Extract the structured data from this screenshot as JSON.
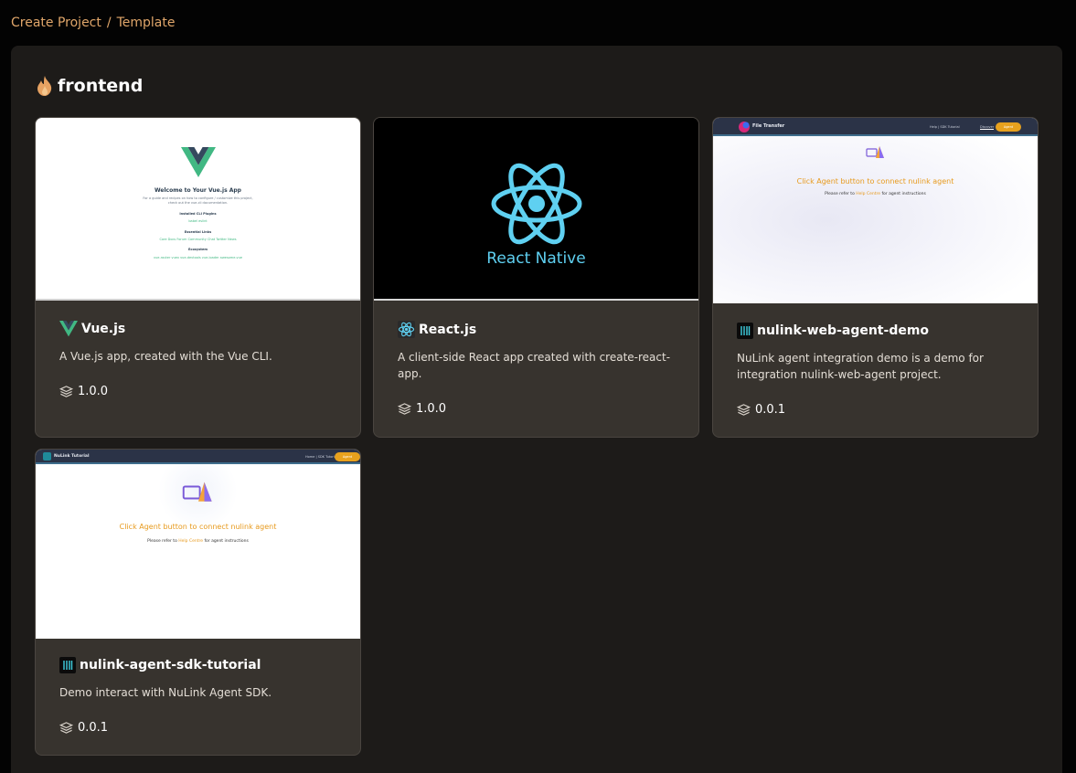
{
  "breadcrumb": {
    "root": "Create Project",
    "separator": "/",
    "current": "Template"
  },
  "section": {
    "title": "frontend",
    "icon": "flame-icon"
  },
  "colors": {
    "accent": "#e0a66a",
    "panel": "#1d1b19",
    "card": "#37332e",
    "agent_orange": "#e79a1d",
    "vue_green": "#42b983",
    "react_blue": "#5fd0f1"
  },
  "cards": [
    {
      "title": "Vue.js",
      "icon": "vue-logo-icon",
      "description": "A Vue.js app, created with the Vue CLI.",
      "version": "1.0.0",
      "preview": {
        "heading": "Welcome to Your Vue.js App",
        "intro1": "For a guide and recipes on how to configure / customize this project,",
        "intro2": "check out the vue-cli documentation.",
        "plugins_title": "Installed CLI Plugins",
        "plugins": "babel   eslint",
        "links_title": "Essential Links",
        "links": "Core Docs   Forum   Community Chat   Twitter   News",
        "eco_title": "Ecosystem",
        "eco": "vue-router   vuex   vue-devtools   vue-loader   awesome-vue"
      }
    },
    {
      "title": "React.js",
      "icon": "react-logo-icon",
      "description": "A client-side React app created with create-react-app.",
      "version": "1.0.0",
      "preview": {
        "label": "React Native"
      }
    },
    {
      "title": "nulink-web-agent-demo",
      "icon": "nulink-logo-icon",
      "description": "NuLink agent integration demo is a demo for integration nulink-web-agent project.",
      "version": "0.0.1",
      "preview": {
        "brand": "File Transfer",
        "nav_link": "Help | SDK Tutorial",
        "nav_item": "Discover",
        "agent_button": "Agent",
        "message": "Click Agent button to connect nulink agent",
        "sub_before": "Please refer to ",
        "sub_link": "Help Centre",
        "sub_after": " for agent instructions"
      }
    },
    {
      "title": "nulink-agent-sdk-tutorial",
      "icon": "nulink-logo-icon",
      "description": "Demo interact with NuLink Agent SDK.",
      "version": "0.0.1",
      "preview": {
        "brand": "NuLink Tutorial",
        "nav_link": "Home | SDK Tutorial",
        "agent_button": "Agent",
        "message": "Click Agent button to connect nulink agent",
        "sub_before": "Please refer to ",
        "sub_link": "Help Centre",
        "sub_after": " for agent instructions"
      }
    }
  ]
}
